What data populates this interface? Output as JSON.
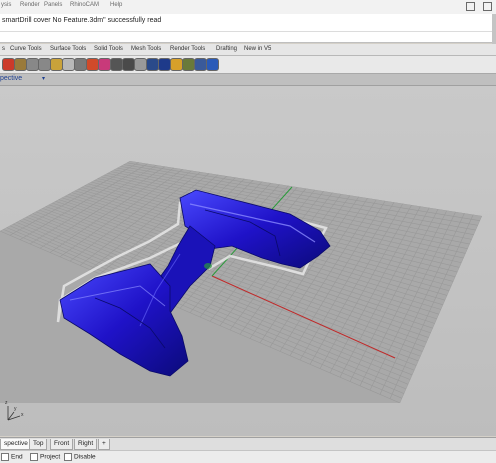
{
  "menu": [
    "ysis",
    "Render",
    "Panels",
    "RhinoCAM",
    "Help"
  ],
  "command_history": "smartDrill cover No Feature.3dm\" successfully read",
  "toolbar_tabs": [
    "s",
    "Curve Tools",
    "Surface Tools",
    "Solid Tools",
    "Mesh Tools",
    "Render Tools",
    "Drafting",
    "New in V5"
  ],
  "tool_icons": [
    {
      "name": "select-icon",
      "color": "#cc3a2a"
    },
    {
      "name": "plus-icon",
      "color": "#9a7a3a"
    },
    {
      "name": "zoom-window-icon",
      "color": "#888888"
    },
    {
      "name": "zoom-extents-icon",
      "color": "#888888"
    },
    {
      "name": "zoom-selected-icon",
      "color": "#c9a23a"
    },
    {
      "name": "light-bulb-icon",
      "color": "#b8b8b8"
    },
    {
      "name": "lock-icon",
      "color": "#7a7a7a"
    },
    {
      "name": "layer-icon",
      "color": "#d04a2a"
    },
    {
      "name": "color-wheel-icon",
      "color": "#c83a7a"
    },
    {
      "name": "sphere-render-icon",
      "color": "#555555"
    },
    {
      "name": "ghosted-icon",
      "color": "#4a4a4a"
    },
    {
      "name": "rendered-icon",
      "color": "#9a9a9a"
    },
    {
      "name": "shaded-icon",
      "color": "#2a4a8a"
    },
    {
      "name": "teapot-icon",
      "color": "#1e3a8a"
    },
    {
      "name": "render-icon",
      "color": "#d7a02a"
    },
    {
      "name": "material-icon",
      "color": "#6a7a3a"
    },
    {
      "name": "options-icon",
      "color": "#3a5a9a"
    },
    {
      "name": "help-icon",
      "color": "#2a5ab8"
    }
  ],
  "viewport_title": "pective",
  "viewport_caret": "▾",
  "view_tabs": [
    "spective",
    "Top",
    "Front",
    "Right",
    "+"
  ],
  "osnap": [
    "End",
    "Project",
    "Disable"
  ],
  "colors": {
    "model": "#1f12c8",
    "model_dark": "#0b0a7a",
    "model_light": "#6a6aff",
    "grid_bg": "#a7a7a7",
    "grid_line": "#9a9a9a",
    "x_axis": "#c02a2a",
    "y_axis": "#2a9a3a"
  }
}
